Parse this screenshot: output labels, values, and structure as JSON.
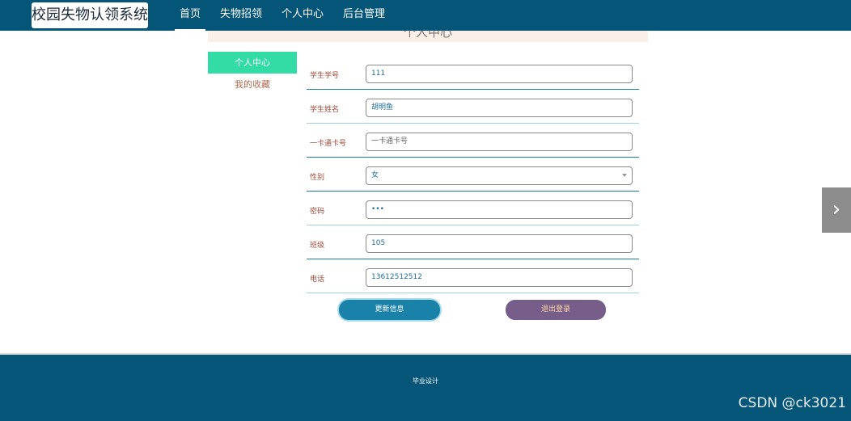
{
  "brand": "校园失物认领系统",
  "nav": {
    "items": [
      "首页",
      "失物招领",
      "个人中心",
      "后台管理"
    ]
  },
  "page_title": "个人中心",
  "side_menu": {
    "active": "个人中心",
    "favorites": "我的收藏"
  },
  "form": {
    "student_no": {
      "label": "学生学号",
      "value": "111"
    },
    "student_name": {
      "label": "学生姓名",
      "value": "胡明鱼"
    },
    "card_no": {
      "label": "一卡通卡号",
      "placeholder": "一卡通卡号"
    },
    "gender": {
      "label": "性别",
      "value": "女"
    },
    "password": {
      "label": "密码",
      "value": "•••"
    },
    "class": {
      "label": "班级",
      "value": "105"
    },
    "phone": {
      "label": "电话",
      "value": "13612512512"
    }
  },
  "buttons": {
    "update": "更新信息",
    "logout": "退出登录"
  },
  "slider_next": "›",
  "footer": "毕业设计",
  "watermark": "CSDN @ck3021"
}
